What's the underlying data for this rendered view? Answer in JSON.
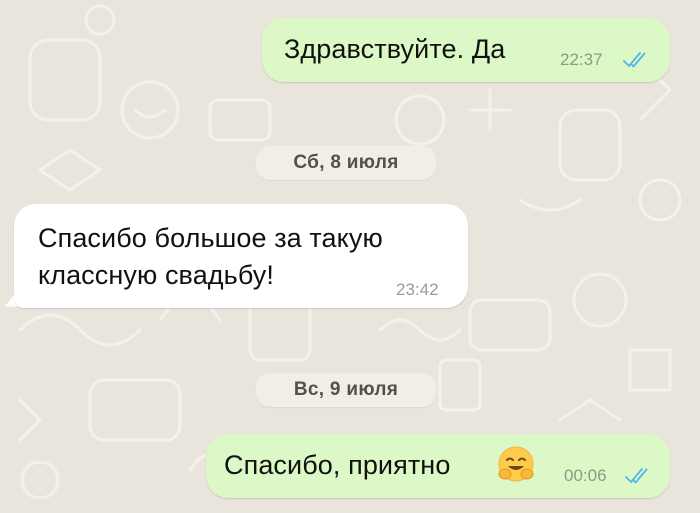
{
  "colors": {
    "background": "#e9e5dd",
    "outgoing_bubble": "#dcf8c6",
    "incoming_bubble": "#ffffff",
    "read_ticks": "#4fb6ec"
  },
  "messages": [
    {
      "direction": "outgoing",
      "text": "Здравствуйте. Да",
      "time": "22:37",
      "status_icon": "double-check-read-icon"
    },
    {
      "date_label": "Сб, 8 июля"
    },
    {
      "direction": "incoming",
      "text_line1": "Спасибо большое за такую",
      "text_line2": "классную свадьбу!",
      "time": "23:42"
    },
    {
      "date_label": "Вс, 9 июля"
    },
    {
      "direction": "outgoing",
      "text": "Спасибо, приятно",
      "emoji": "hugging-face-emoji",
      "time": "00:06",
      "status_icon": "double-check-read-icon"
    }
  ]
}
